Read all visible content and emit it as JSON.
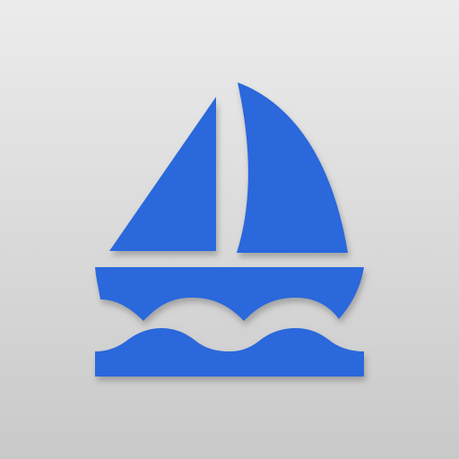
{
  "icon": {
    "name": "sailboat-icon",
    "colors": {
      "fill": "#2a68db",
      "shadow": "#7a7a7a",
      "background_top": "#ececec",
      "background_bottom": "#c9c9c9"
    }
  }
}
